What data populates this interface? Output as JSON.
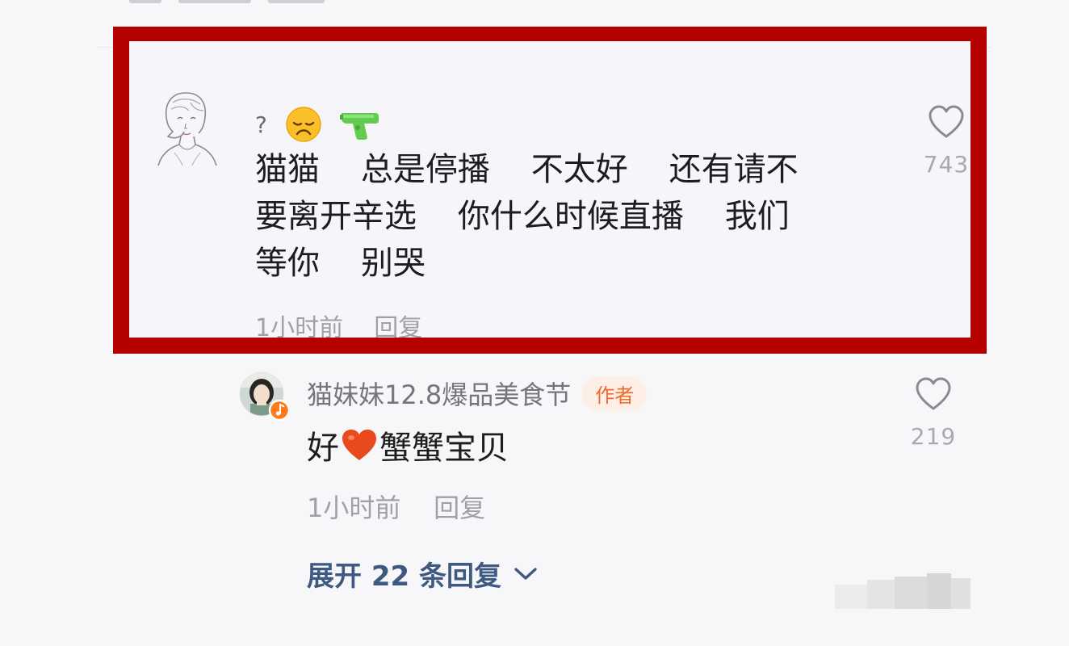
{
  "comment": {
    "username_symbol": "?",
    "emojis": [
      "disappointed-face",
      "water-pistol"
    ],
    "text_lines": [
      "猫猫    总是停播    不太好    还有请不",
      "要离开辛选    你什么时候直播    我们",
      "等你    别哭"
    ],
    "time": "1小时前",
    "reply_label": "回复",
    "like_count": "743"
  },
  "reply": {
    "username": "猫妹妹12.8爆品美食节",
    "author_badge": "作者",
    "text_before": "好",
    "text_after": "蟹蟹宝贝",
    "time": "1小时前",
    "reply_label": "回复",
    "like_count": "219"
  },
  "expand": {
    "label": "展开 22 条回复"
  },
  "colors": {
    "highlight_border": "#b50000",
    "author_badge": "#f06a2c",
    "expand_link": "#3e5a82",
    "meta_text": "#a0a0a6"
  },
  "icons": {
    "like": "heart-outline-icon",
    "expand": "chevron-down-icon",
    "reply_emoji": "red-heart-emoji"
  }
}
